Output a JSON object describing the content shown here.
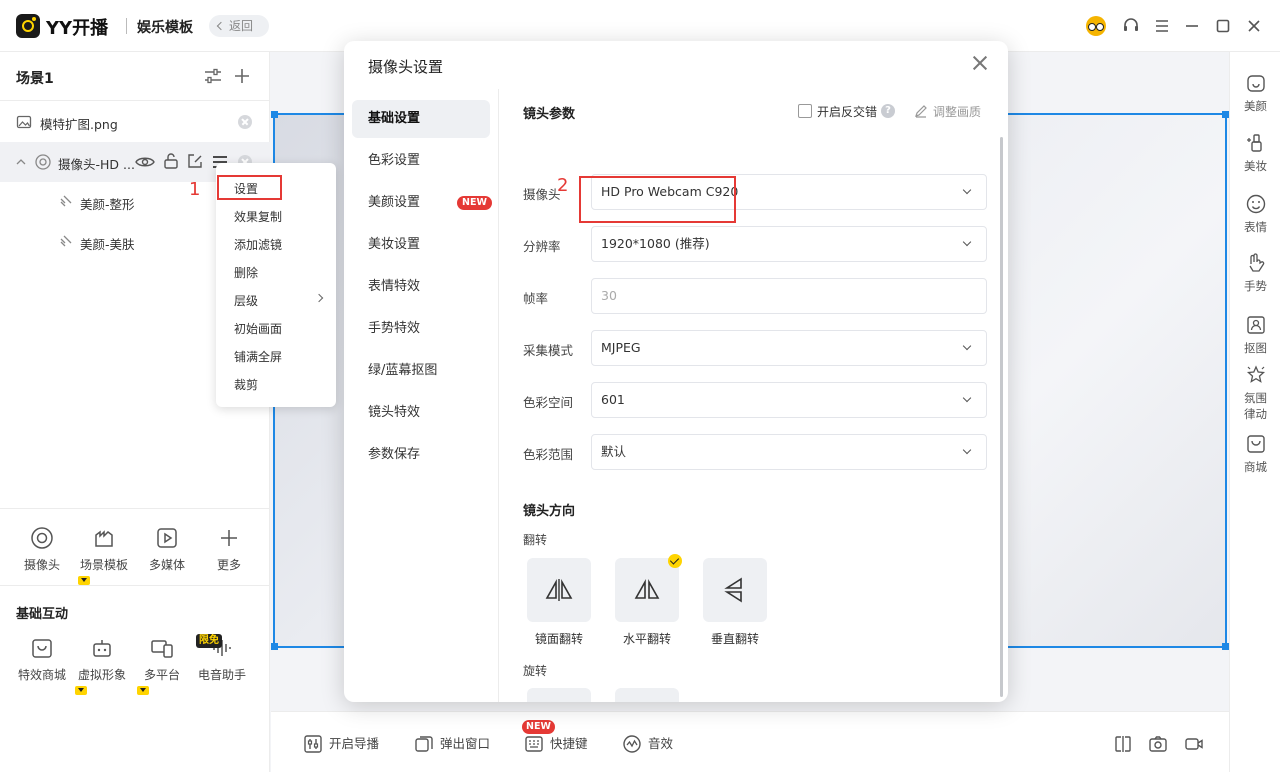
{
  "app": {
    "title": "YY开播",
    "mode": "娱乐模板",
    "back_label": "返回"
  },
  "scene": {
    "title": "场景1"
  },
  "sources": [
    {
      "label": "模特扩图.png"
    },
    {
      "label": "摄像头-HD ..."
    },
    {
      "label": "美颜-整形"
    },
    {
      "label": "美颜-美肤"
    }
  ],
  "context_menu": {
    "items": [
      "设置",
      "效果复制",
      "添加滤镜",
      "删除",
      "层级",
      "初始画面",
      "铺满全屏",
      "裁剪"
    ]
  },
  "annotations": {
    "one": "1",
    "two": "2"
  },
  "tools": [
    "摄像头",
    "场景模板",
    "多媒体",
    "更多"
  ],
  "basic_interaction": {
    "title": "基础互动",
    "items": [
      "特效商城",
      "虚拟形象",
      "多平台",
      "电音助手"
    ],
    "free_badge": "限免"
  },
  "right_bar": [
    "美颜",
    "美妆",
    "表情",
    "手势",
    "抠图",
    "氛围律动",
    "商城"
  ],
  "bottom_bar": {
    "items": [
      "开启导播",
      "弹出窗口",
      "快捷键",
      "音效"
    ],
    "new_badge": "NEW"
  },
  "dialog": {
    "title": "摄像头设置",
    "nav": [
      "基础设置",
      "色彩设置",
      "美颜设置",
      "美妆设置",
      "表情特效",
      "手势特效",
      "绿/蓝幕抠图",
      "镜头特效",
      "参数保存"
    ],
    "nav_new_badge": "NEW",
    "lens_params_title": "镜头参数",
    "anti_interlace_label": "开启反交错",
    "help_glyph": "?",
    "adjust_label": "调整画质",
    "fields": [
      {
        "label": "摄像头",
        "value": "HD Pro Webcam C920"
      },
      {
        "label": "分辨率",
        "value": "1920*1080 (推荐)"
      },
      {
        "label": "帧率",
        "value": "30"
      },
      {
        "label": "采集模式",
        "value": "MJPEG"
      },
      {
        "label": "色彩空间",
        "value": "601"
      },
      {
        "label": "色彩范围",
        "value": "默认"
      }
    ],
    "direction_title": "镜头方向",
    "flip_label": "翻转",
    "flip_options": [
      "镜面翻转",
      "水平翻转",
      "垂直翻转"
    ],
    "rotate_label": "旋转"
  }
}
